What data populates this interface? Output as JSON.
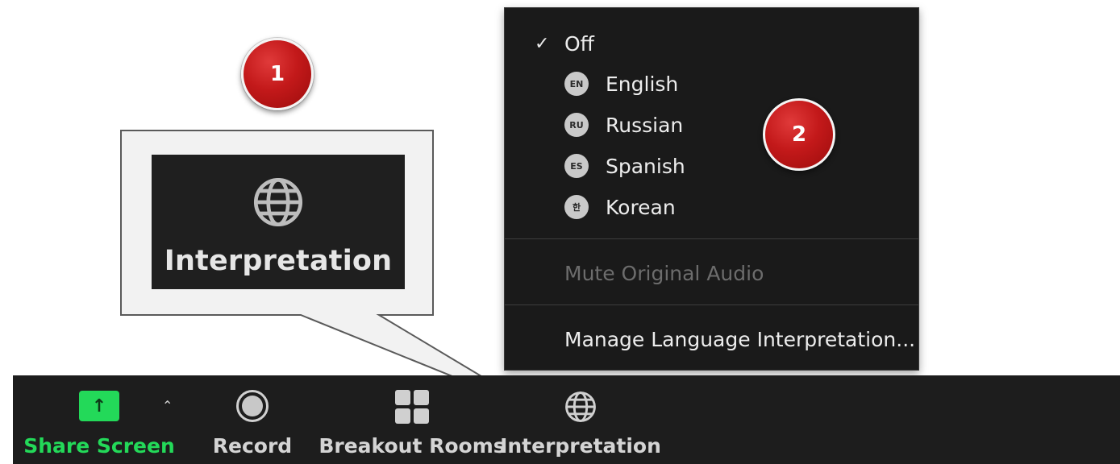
{
  "callout": {
    "zoomed_label": "Interpretation",
    "zoomed_icon": "globe-icon"
  },
  "badges": {
    "step1": "1",
    "step2": "2"
  },
  "menu": {
    "off": {
      "label": "Off",
      "checked": true,
      "check_glyph": "✓"
    },
    "languages": [
      {
        "code": "EN",
        "label": "English"
      },
      {
        "code": "RU",
        "label": "Russian"
      },
      {
        "code": "ES",
        "label": "Spanish"
      },
      {
        "code": "한",
        "label": "Korean"
      }
    ],
    "mute_original_audio": {
      "label": "Mute Original Audio",
      "enabled": false
    },
    "manage": {
      "label": "Manage Language Interpretation..."
    }
  },
  "toolbar": {
    "share_screen": {
      "label": "Share Screen",
      "icon": "share-arrow-up-icon",
      "color": "#23d959",
      "arrow": "↑"
    },
    "share_options_caret": "⌃",
    "record": {
      "label": "Record",
      "icon": "record-icon"
    },
    "breakout_rooms": {
      "label": "Breakout Rooms",
      "icon": "grid-icon"
    },
    "interpretation": {
      "label": "Interpretation",
      "icon": "globe-icon"
    }
  },
  "colors": {
    "accent_green": "#23d959",
    "badge_red": "#c3191a",
    "toolbar_bg": "#1d1d1d",
    "menu_bg": "#1a1a1a"
  }
}
